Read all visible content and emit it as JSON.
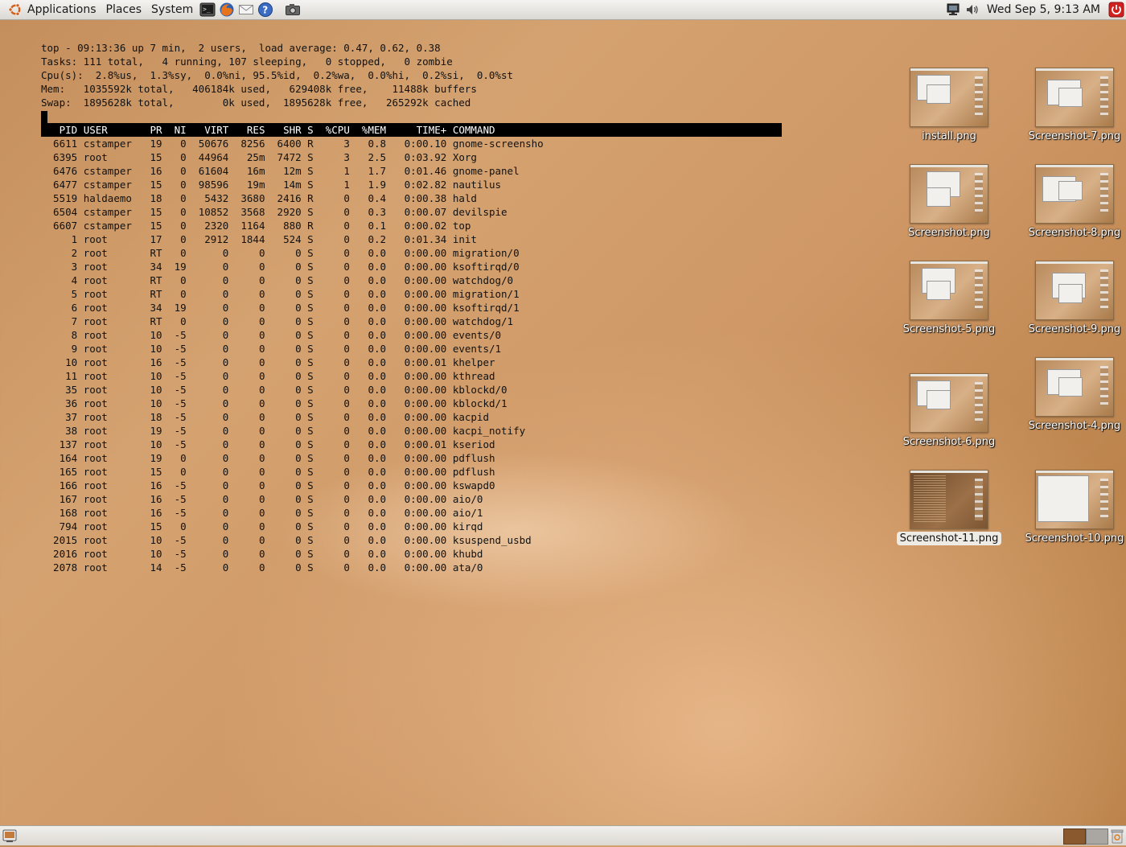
{
  "panel": {
    "menus": [
      "Applications",
      "Places",
      "System"
    ],
    "launchers": [
      "terminal-icon",
      "firefox-icon",
      "mail-icon",
      "help-icon",
      "camera-icon"
    ],
    "clock": "Wed Sep  5,  9:13 AM"
  },
  "terminal": {
    "summary": [
      "top - 09:13:36 up 7 min,  2 users,  load average: 0.47, 0.62, 0.38",
      "Tasks: 111 total,   4 running, 107 sleeping,   0 stopped,   0 zombie",
      "Cpu(s):  2.8%us,  1.3%sy,  0.0%ni, 95.5%id,  0.2%wa,  0.0%hi,  0.2%si,  0.0%st",
      "Mem:   1035592k total,   406184k used,   629408k free,    11488k buffers",
      "Swap:  1895628k total,        0k used,  1895628k free,   265292k cached"
    ],
    "columns": [
      "PID",
      "USER",
      "PR",
      "NI",
      "VIRT",
      "RES",
      "SHR",
      "S",
      "%CPU",
      "%MEM",
      "TIME+",
      "COMMAND"
    ],
    "rows": [
      [
        "6611",
        "cstamper",
        "19",
        "0",
        "50676",
        "8256",
        "6400",
        "R",
        "3",
        "0.8",
        "0:00.10",
        "gnome-screensho"
      ],
      [
        "6395",
        "root",
        "15",
        "0",
        "44964",
        "25m",
        "7472",
        "S",
        "3",
        "2.5",
        "0:03.92",
        "Xorg"
      ],
      [
        "6476",
        "cstamper",
        "16",
        "0",
        "61604",
        "16m",
        "12m",
        "S",
        "1",
        "1.7",
        "0:01.46",
        "gnome-panel"
      ],
      [
        "6477",
        "cstamper",
        "15",
        "0",
        "98596",
        "19m",
        "14m",
        "S",
        "1",
        "1.9",
        "0:02.82",
        "nautilus"
      ],
      [
        "5519",
        "haldaemo",
        "18",
        "0",
        "5432",
        "3680",
        "2416",
        "R",
        "0",
        "0.4",
        "0:00.38",
        "hald"
      ],
      [
        "6504",
        "cstamper",
        "15",
        "0",
        "10852",
        "3568",
        "2920",
        "S",
        "0",
        "0.3",
        "0:00.07",
        "devilspie"
      ],
      [
        "6607",
        "cstamper",
        "15",
        "0",
        "2320",
        "1164",
        "880",
        "R",
        "0",
        "0.1",
        "0:00.02",
        "top"
      ],
      [
        "1",
        "root",
        "17",
        "0",
        "2912",
        "1844",
        "524",
        "S",
        "0",
        "0.2",
        "0:01.34",
        "init"
      ],
      [
        "2",
        "root",
        "RT",
        "0",
        "0",
        "0",
        "0",
        "S",
        "0",
        "0.0",
        "0:00.00",
        "migration/0"
      ],
      [
        "3",
        "root",
        "34",
        "19",
        "0",
        "0",
        "0",
        "S",
        "0",
        "0.0",
        "0:00.00",
        "ksoftirqd/0"
      ],
      [
        "4",
        "root",
        "RT",
        "0",
        "0",
        "0",
        "0",
        "S",
        "0",
        "0.0",
        "0:00.00",
        "watchdog/0"
      ],
      [
        "5",
        "root",
        "RT",
        "0",
        "0",
        "0",
        "0",
        "S",
        "0",
        "0.0",
        "0:00.00",
        "migration/1"
      ],
      [
        "6",
        "root",
        "34",
        "19",
        "0",
        "0",
        "0",
        "S",
        "0",
        "0.0",
        "0:00.00",
        "ksoftirqd/1"
      ],
      [
        "7",
        "root",
        "RT",
        "0",
        "0",
        "0",
        "0",
        "S",
        "0",
        "0.0",
        "0:00.00",
        "watchdog/1"
      ],
      [
        "8",
        "root",
        "10",
        "-5",
        "0",
        "0",
        "0",
        "S",
        "0",
        "0.0",
        "0:00.00",
        "events/0"
      ],
      [
        "9",
        "root",
        "10",
        "-5",
        "0",
        "0",
        "0",
        "S",
        "0",
        "0.0",
        "0:00.00",
        "events/1"
      ],
      [
        "10",
        "root",
        "16",
        "-5",
        "0",
        "0",
        "0",
        "S",
        "0",
        "0.0",
        "0:00.01",
        "khelper"
      ],
      [
        "11",
        "root",
        "10",
        "-5",
        "0",
        "0",
        "0",
        "S",
        "0",
        "0.0",
        "0:00.00",
        "kthread"
      ],
      [
        "35",
        "root",
        "10",
        "-5",
        "0",
        "0",
        "0",
        "S",
        "0",
        "0.0",
        "0:00.00",
        "kblockd/0"
      ],
      [
        "36",
        "root",
        "10",
        "-5",
        "0",
        "0",
        "0",
        "S",
        "0",
        "0.0",
        "0:00.00",
        "kblockd/1"
      ],
      [
        "37",
        "root",
        "18",
        "-5",
        "0",
        "0",
        "0",
        "S",
        "0",
        "0.0",
        "0:00.00",
        "kacpid"
      ],
      [
        "38",
        "root",
        "19",
        "-5",
        "0",
        "0",
        "0",
        "S",
        "0",
        "0.0",
        "0:00.00",
        "kacpi_notify"
      ],
      [
        "137",
        "root",
        "10",
        "-5",
        "0",
        "0",
        "0",
        "S",
        "0",
        "0.0",
        "0:00.01",
        "kseriod"
      ],
      [
        "164",
        "root",
        "19",
        "0",
        "0",
        "0",
        "0",
        "S",
        "0",
        "0.0",
        "0:00.00",
        "pdflush"
      ],
      [
        "165",
        "root",
        "15",
        "0",
        "0",
        "0",
        "0",
        "S",
        "0",
        "0.0",
        "0:00.00",
        "pdflush"
      ],
      [
        "166",
        "root",
        "16",
        "-5",
        "0",
        "0",
        "0",
        "S",
        "0",
        "0.0",
        "0:00.00",
        "kswapd0"
      ],
      [
        "167",
        "root",
        "16",
        "-5",
        "0",
        "0",
        "0",
        "S",
        "0",
        "0.0",
        "0:00.00",
        "aio/0"
      ],
      [
        "168",
        "root",
        "16",
        "-5",
        "0",
        "0",
        "0",
        "S",
        "0",
        "0.0",
        "0:00.00",
        "aio/1"
      ],
      [
        "794",
        "root",
        "15",
        "0",
        "0",
        "0",
        "0",
        "S",
        "0",
        "0.0",
        "0:00.00",
        "kirqd"
      ],
      [
        "2015",
        "root",
        "10",
        "-5",
        "0",
        "0",
        "0",
        "S",
        "0",
        "0.0",
        "0:00.00",
        "ksuspend_usbd"
      ],
      [
        "2016",
        "root",
        "10",
        "-5",
        "0",
        "0",
        "0",
        "S",
        "0",
        "0.0",
        "0:00.00",
        "khubd"
      ],
      [
        "2078",
        "root",
        "14",
        "-5",
        "0",
        "0",
        "0",
        "S",
        "0",
        "0.0",
        "0:00.00",
        "ata/0"
      ]
    ]
  },
  "desktop_icons": [
    {
      "label": "install.png",
      "style": "light",
      "selected": false
    },
    {
      "label": "Screenshot-7.png",
      "style": "light",
      "selected": false
    },
    {
      "label": "Screenshot.png",
      "style": "light",
      "selected": false
    },
    {
      "label": "Screenshot-8.png",
      "style": "light",
      "selected": false
    },
    {
      "label": "Screenshot-5.png",
      "style": "light",
      "selected": false
    },
    {
      "label": "Screenshot-9.png",
      "style": "light",
      "selected": false
    },
    {
      "label": "Screenshot-6.png",
      "style": "light",
      "selected": false
    },
    {
      "label": "Screenshot-4.png",
      "style": "light",
      "selected": false
    },
    {
      "label": "Screenshot-11.png",
      "style": "dark",
      "selected": true
    },
    {
      "label": "Screenshot-10.png",
      "style": "white",
      "selected": false
    }
  ],
  "colors": {
    "panel_bg": "#dcd9d3",
    "terminal_header_bg": "#000000",
    "workspace_active": "#8a5a2e",
    "workspace_inactive": "#aaa7a2",
    "quit_red": "#d21f1f"
  }
}
